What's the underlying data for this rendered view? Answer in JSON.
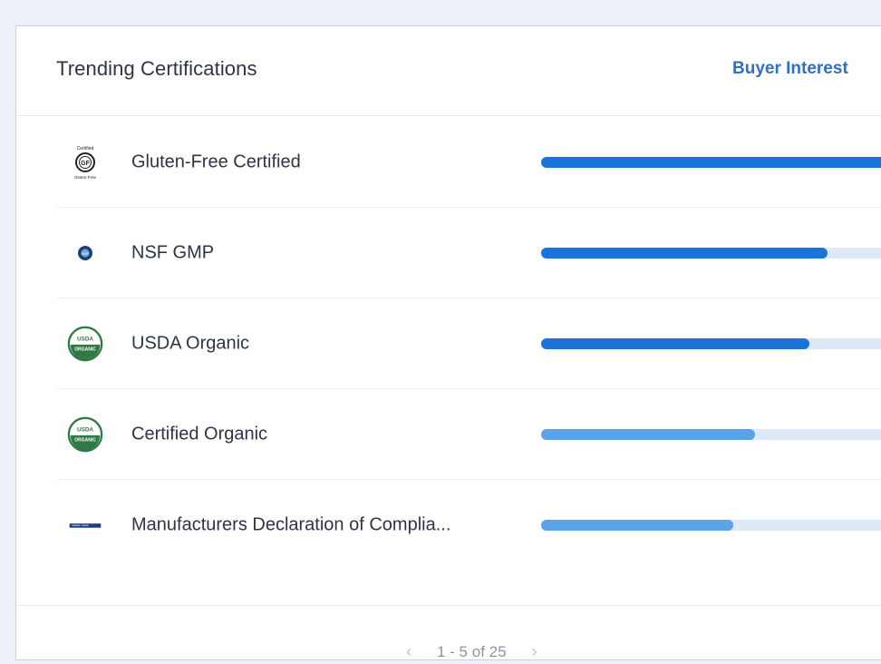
{
  "card": {
    "title": "Trending Certifications",
    "buyer_interest_label": "Buyer Interest"
  },
  "colors": {
    "strong": "#1a73d6",
    "light": "#5aa3e8",
    "track": "#dde9f7"
  },
  "rows": [
    {
      "label": "Gluten-Free Certified",
      "icon": "gluten-free-icon",
      "interest": 0.97,
      "tone": "strong"
    },
    {
      "label": "NSF GMP",
      "icon": "nsf-gmp-icon",
      "interest": 0.79,
      "tone": "strong"
    },
    {
      "label": "USDA Organic",
      "icon": "usda-organic-icon",
      "interest": 0.74,
      "tone": "strong"
    },
    {
      "label": "Certified Organic",
      "icon": "usda-organic-icon",
      "interest": 0.59,
      "tone": "light"
    },
    {
      "label": "Manufacturers Declaration of Complia...",
      "icon": "declaration-icon",
      "interest": 0.53,
      "tone": "light"
    }
  ],
  "pagination": {
    "range": "1 - 5 of 25",
    "prev_icon": "chevron-left-icon",
    "next_icon": "chevron-right-icon"
  },
  "icon_text": {
    "gf_top": "Certified",
    "gf_mid": "GF",
    "gf_bottom": "Gluten-Free",
    "nsf": "NSF",
    "usda_top": "USDA",
    "usda_bottom": "ORGANIC"
  }
}
